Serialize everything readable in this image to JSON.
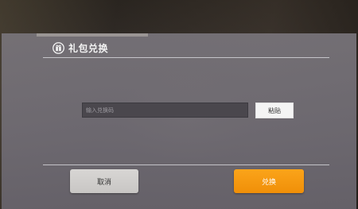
{
  "dialog": {
    "title": "礼包兑换",
    "title_icon": "gift-badge-icon",
    "input_placeholder": "输入兑换码",
    "paste_label": "粘贴",
    "cancel_label": "取消",
    "confirm_label": "兑换"
  },
  "colors": {
    "dialog_bg": "#78747a",
    "confirm_accent": "#f59a10",
    "cancel_bg": "#d0cecc",
    "input_bg": "#4a474d"
  }
}
